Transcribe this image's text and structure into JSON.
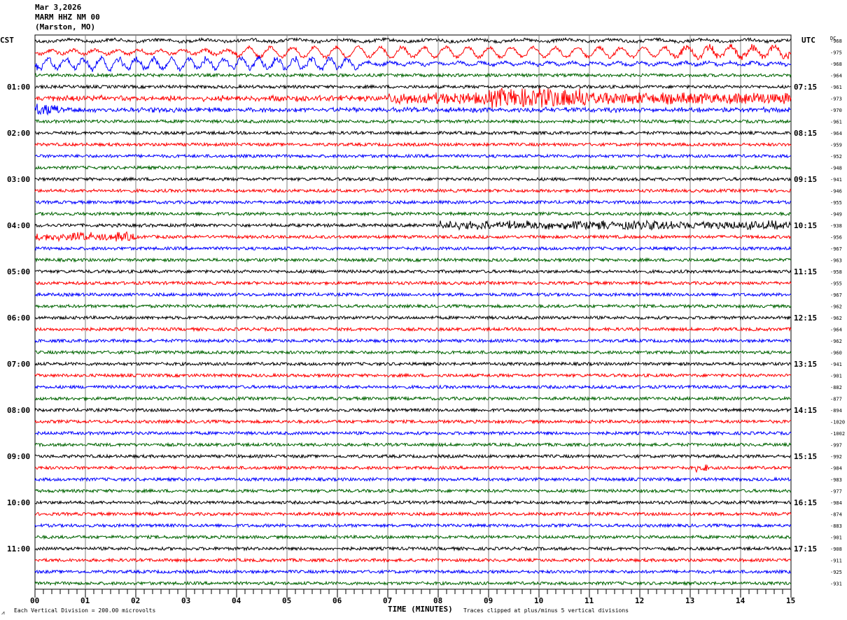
{
  "header": {
    "date": "Mar 3,2026",
    "station": "MARM HHZ NM 00",
    "location": "(Marston, MO)"
  },
  "chart_data": {
    "type": "line",
    "title": "MARM HHZ NM 00",
    "xlabel": "TIME (MINUTES)",
    "xlim": [
      0,
      15
    ],
    "x_ticks": [
      "00",
      "01",
      "02",
      "03",
      "04",
      "05",
      "06",
      "07",
      "08",
      "09",
      "10",
      "11",
      "12",
      "13",
      "14",
      "15"
    ],
    "left_axis_title": "CST",
    "right_axis_title": "UTC",
    "dc_title": "DC",
    "left_labels": [
      "01:00",
      "02:00",
      "03:00",
      "04:00",
      "05:00",
      "06:00",
      "07:00",
      "08:00",
      "09:00",
      "10:00",
      "11:00"
    ],
    "right_labels": [
      "07:15",
      "08:15",
      "09:15",
      "10:15",
      "11:15",
      "12:15",
      "13:15",
      "14:15",
      "15:15",
      "16:15",
      "17:15"
    ],
    "trace_colors": [
      "#000000",
      "#ff0000",
      "#0000ff",
      "#006400"
    ],
    "dc_offsets": [
      -968,
      -975,
      -968,
      -964,
      -961,
      -973,
      -970,
      -961,
      -964,
      -959,
      -952,
      -948,
      -941,
      -946,
      -955,
      -949,
      -938,
      -956,
      -967,
      -963,
      -958,
      -955,
      -967,
      -962,
      -962,
      -964,
      -962,
      -960,
      -941,
      -901,
      -882,
      -877,
      -894,
      -1020,
      -1002,
      -997,
      -992,
      -984,
      -983,
      -977,
      -984,
      -874,
      -883,
      -901,
      -908,
      -911,
      -925,
      -931
    ],
    "scale_note": "Each Vertical Division =  200.00 microvolts",
    "clip_note": "Traces clipped at plus/minus 5 vertical divisions",
    "grid": true
  }
}
